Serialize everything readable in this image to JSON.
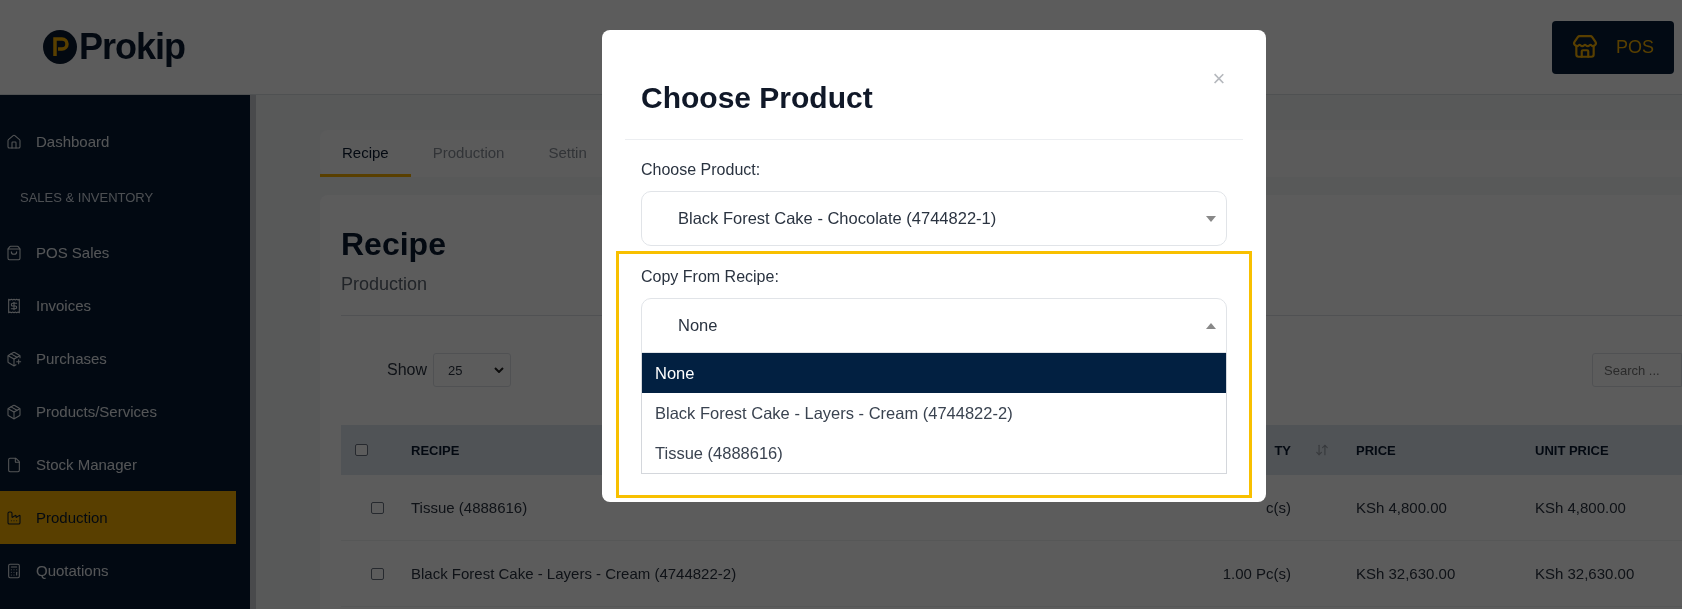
{
  "header": {
    "logo_text": "Prokip",
    "pos_button": "POS"
  },
  "sidebar": {
    "items": [
      {
        "kind": "link",
        "label": "Dashboard",
        "selected": false
      },
      {
        "kind": "section",
        "label": "SALES & INVENTORY",
        "selected": false
      },
      {
        "kind": "link",
        "label": "POS Sales",
        "selected": false
      },
      {
        "kind": "link",
        "label": "Invoices",
        "selected": false
      },
      {
        "kind": "link",
        "label": "Purchases",
        "selected": false
      },
      {
        "kind": "link",
        "label": "Products/Services",
        "selected": false
      },
      {
        "kind": "link",
        "label": "Stock Manager",
        "selected": false
      },
      {
        "kind": "link",
        "label": "Production",
        "selected": true
      },
      {
        "kind": "link",
        "label": "Quotations",
        "selected": false
      }
    ]
  },
  "tabs": [
    {
      "label": "Recipe",
      "selected": true
    },
    {
      "label": "Production",
      "selected": false
    },
    {
      "label": "Settin",
      "selected": false
    }
  ],
  "page": {
    "title": "Recipe",
    "subtitle": "Production",
    "show_label": "Show",
    "page_size": "25",
    "search": {
      "placeholder": "Search ..."
    }
  },
  "table": {
    "header_checked": false,
    "columns": [
      {
        "kind": "text",
        "label": "RECIPE"
      },
      {
        "kind": "quantity",
        "label": "TY"
      },
      {
        "kind": "text",
        "label": "PRICE"
      },
      {
        "kind": "text",
        "label": "UNIT PRICE"
      }
    ],
    "rows": [
      {
        "checked": false,
        "cells": [
          "Tissue (4888616)",
          "c(s)",
          "KSh 4,800.00",
          "KSh 4,800.00"
        ]
      },
      {
        "checked": false,
        "cells": [
          "Black Forest Cake - Layers - Cream (4744822-2)",
          "1.00 Pc(s)",
          "KSh 32,630.00",
          "KSh 32,630.00"
        ]
      }
    ]
  },
  "modal": {
    "title": "Choose Product",
    "close": "×",
    "fields": [
      {
        "label": "Choose Product:",
        "value": "Black Forest Cake - Chocolate (4744822-1)",
        "expanded": false,
        "highlighted": false
      },
      {
        "label": "Copy From Recipe:",
        "value": "None",
        "expanded": true,
        "highlighted": true,
        "options": [
          {
            "label": "None",
            "selected": true
          },
          {
            "label": "Black Forest Cake - Layers - Cream (4744822-2)",
            "selected": false
          },
          {
            "label": "Tissue (4888616)",
            "selected": false
          }
        ]
      }
    ]
  }
}
